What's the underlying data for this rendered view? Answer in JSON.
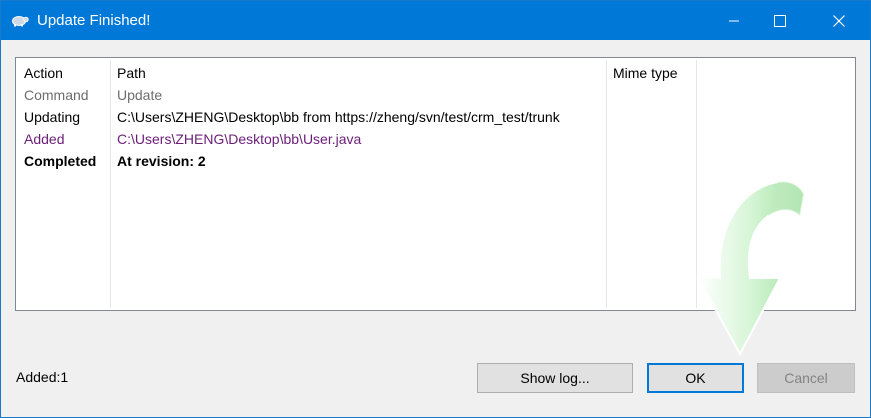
{
  "window": {
    "title": "Update Finished!",
    "icon": "tortoise-icon",
    "controls": [
      "minimize-icon",
      "maximize-icon",
      "close-icon"
    ]
  },
  "list": {
    "headers": {
      "action": "Action",
      "path": "Path",
      "mime": "Mime type"
    },
    "rows": [
      {
        "action": "Command",
        "path": "Update",
        "color": "#6d6d6d"
      },
      {
        "action": "Updating",
        "path": "C:\\Users\\ZHENG\\Desktop\\bb from https://zheng/svn/test/crm_test/trunk",
        "color": "#000000"
      },
      {
        "action": "Added",
        "path": "C:\\Users\\ZHENG\\Desktop\\bb\\User.java",
        "color": "#6b1e78"
      },
      {
        "action": "Completed",
        "path": "At revision: 2",
        "color": "#000000",
        "bold": true
      }
    ]
  },
  "status": {
    "text": "Added:1"
  },
  "buttons": {
    "show_log": "Show log...",
    "ok": "OK",
    "cancel": "Cancel"
  },
  "colors": {
    "titlebar": "#0078d7",
    "ok_border": "#0078d7"
  }
}
